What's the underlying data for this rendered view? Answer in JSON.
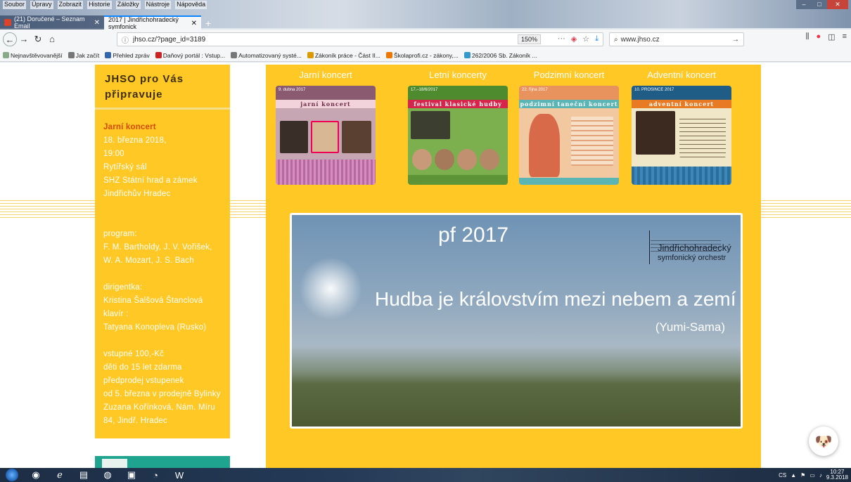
{
  "browser": {
    "menu": [
      "Soubor",
      "Úpravy",
      "Zobrazit",
      "Historie",
      "Záložky",
      "Nástroje",
      "Nápověda"
    ],
    "tabs": [
      {
        "label": "(21) Doručené – Seznam Email",
        "active": false
      },
      {
        "label": "2017 | Jindřichohradecký symfonick",
        "active": true
      }
    ],
    "url": "jhso.cz/?page_id=3189",
    "zoom": "150%",
    "search_value": "www.jhso.cz",
    "bookmarks": [
      "Nejnavštěvovanější",
      "Jak začít",
      "Přehled zpráv",
      "Daňový portál : Vstup...",
      "Automatizovaný systé...",
      "Zákoník práce - Část II...",
      "Školaprofi.cz - zákony,...",
      "262/2006 Sb. Zákoník ..."
    ]
  },
  "sidebar": {
    "title": "JHSO pro Vás připravuje",
    "event_name": "Jarní koncert",
    "date": "18. března 2018,",
    "time": "19:00",
    "hall": "Rytířský sál",
    "venue": "SHZ Státní hrad a zámek",
    "city": "Jindřichův Hradec",
    "program_label": "program:",
    "program_1": "F. M. Bartholdy, J. V. Vořišek,",
    "program_2": "W. A. Mozart, J. S. Bach",
    "conductor_label": "dirigentka:",
    "conductor": "Kristina Šalšová Štanclová",
    "piano_label": "klavír :",
    "pianist": "Tatyana Konopleva (Rusko)",
    "price": "vstupné 100,-Kč",
    "kids": "děti do 15 let zdarma",
    "presale": "předprodej vstupenek",
    "presale_from": "od 5. března v prodejně Bylinky",
    "shop": "Zuzana Kořínková, Nám. Míru",
    "address": "84, Jindř. Hradec"
  },
  "concerts": [
    {
      "title": "Jarní koncert",
      "date": "9. dubna 2017",
      "band": "jarní koncert",
      "color": "#b7869a"
    },
    {
      "title": "Letní koncerty",
      "date": "17.–18/6/2017",
      "band": "festival klasické hudby",
      "color": "#6fa34a"
    },
    {
      "title": "Podzimní koncert",
      "date": "22. října 2017",
      "band": "podzimní taneční koncert",
      "color": "#e89a6a"
    },
    {
      "title": "Adventní koncert",
      "date": "10. PROSINCE 2017",
      "band": "adventní koncert",
      "color": "#2a6f9c"
    }
  ],
  "banner": {
    "pf": "pf 2017",
    "motto": "Hudba je královstvím mezi nebem a zemí",
    "author": "(Yumi-Sama)",
    "logo_line1": "Jindřichohradecký",
    "logo_line2": "symfonický orchestr"
  },
  "taskbar": {
    "lang": "CS",
    "time": "10:27",
    "date": "9.3.2018"
  }
}
